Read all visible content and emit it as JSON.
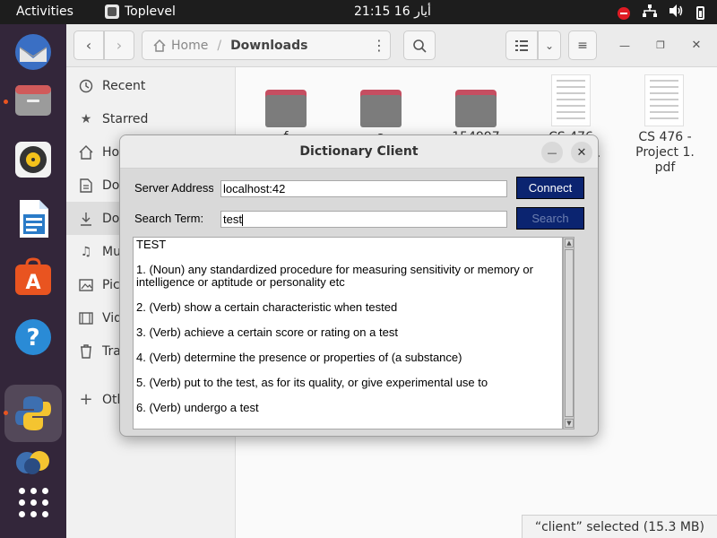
{
  "topbar": {
    "activities": "Activities",
    "app_name": "Toplevel",
    "clock": "21:15  16 أيار"
  },
  "files": {
    "breadcrumb": {
      "home": "Home",
      "current": "Downloads"
    },
    "sidebar": [
      {
        "icon": "clock-icon",
        "label": "Recent"
      },
      {
        "icon": "star-icon",
        "label": "Starred"
      },
      {
        "icon": "home-icon",
        "label": "Home"
      },
      {
        "icon": "document-icon",
        "label": "Documents"
      },
      {
        "icon": "download-icon",
        "label": "Downloads"
      },
      {
        "icon": "music-icon",
        "label": "Music"
      },
      {
        "icon": "picture-icon",
        "label": "Pictures"
      },
      {
        "icon": "video-icon",
        "label": "Videos"
      },
      {
        "icon": "trash-icon",
        "label": "Trash"
      },
      {
        "icon": "plus-icon",
        "label": "Other Locations"
      }
    ],
    "items": [
      {
        "type": "folder",
        "name": ""
      },
      {
        "type": "folder",
        "name": ""
      },
      {
        "type": "folder",
        "name": ""
      },
      {
        "type": "pdf",
        "name": ""
      },
      {
        "type": "pdf",
        "name": "CS 476 - Project 1. pdf"
      }
    ],
    "partial_names": [
      "f",
      "a",
      "C",
      "154997",
      "CS 476",
      "l."
    ],
    "status": "“client” selected  (15.3 MB)"
  },
  "dialog": {
    "title": "Dictionary Client",
    "server_label": "Server Address:",
    "server_value": "localhost:42",
    "connect_label": "Connect",
    "search_label": "Search Term:",
    "search_value": "test",
    "search_button": "Search",
    "result_lines": [
      "TEST",
      "",
      "1. (Noun) any standardized procedure for measuring sensitivity or memory or intelligence or aptitude or personality etc",
      "",
      "2. (Verb) show a certain characteristic when tested",
      "",
      "3. (Verb) achieve a certain score or rating on a test",
      "",
      "4. (Verb) determine the presence or properties of (a substance)",
      "",
      "5. (Verb) put to the test, as for its quality, or give experimental use to",
      "",
      "6. (Verb) undergo a test"
    ]
  },
  "colors": {
    "dock": "#33263a",
    "topbar": "#1d1d1d",
    "button_blue": "#0b2470",
    "accent_orange": "#e95420"
  }
}
